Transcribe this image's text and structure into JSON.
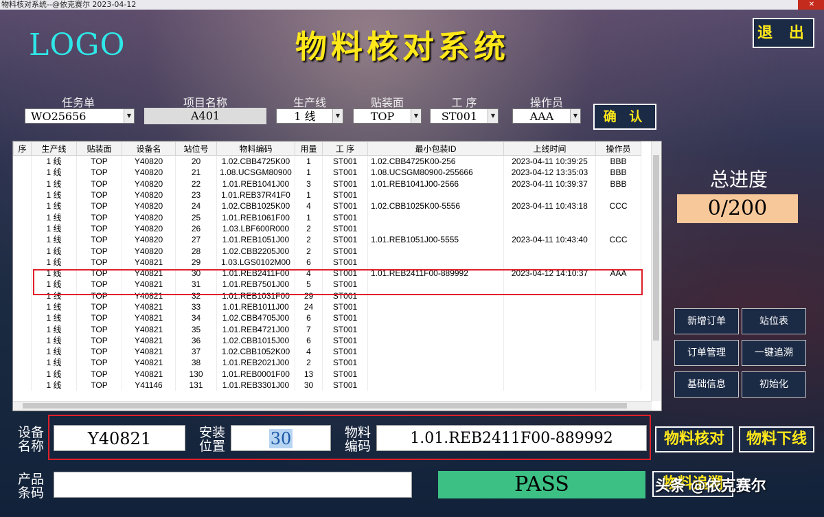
{
  "window": {
    "title": "物料核对系统--@依克赛尔 2023-04-12",
    "close": "✕"
  },
  "header": {
    "logo": "LOGO",
    "title": "物料核对系统",
    "exit_label": "退 出"
  },
  "filters": {
    "task": {
      "label": "任务单",
      "value": "WO25656"
    },
    "project": {
      "label": "项目名称",
      "value": "A401"
    },
    "line": {
      "label": "生产线",
      "value": "1 线"
    },
    "side": {
      "label": "贴装面",
      "value": "TOP"
    },
    "process": {
      "label": "工 序",
      "value": "ST001"
    },
    "operator": {
      "label": "操作员",
      "value": "AAA"
    },
    "confirm_label": "确 认"
  },
  "table": {
    "columns": [
      "序",
      "生产线",
      "贴装面",
      "设备名",
      "站位号",
      "物料编码",
      "用量",
      "工 序",
      "最小包装ID",
      "上线时间",
      "操作员"
    ],
    "rows": [
      [
        "",
        "1 线",
        "TOP",
        "Y40820",
        "20",
        "1.02.CBB4725K00",
        "1",
        "ST001",
        "1.02.CBB4725K00-256",
        "2023-04-11 10:39:25",
        "BBB"
      ],
      [
        "",
        "1 线",
        "TOP",
        "Y40820",
        "21",
        "1.08.UCSGM80900",
        "1",
        "ST001",
        "1.08.UCSGM80900-255666",
        "2023-04-12 13:35:03",
        "BBB"
      ],
      [
        "",
        "1 线",
        "TOP",
        "Y40820",
        "22",
        "1.01.REB1041J00",
        "3",
        "ST001",
        "1.01.REB1041J00-2566",
        "2023-04-11 10:39:37",
        "BBB"
      ],
      [
        "",
        "1 线",
        "TOP",
        "Y40820",
        "23",
        "1.01.REB37R41F0",
        "1",
        "ST001",
        "",
        "",
        ""
      ],
      [
        "",
        "1 线",
        "TOP",
        "Y40820",
        "24",
        "1.02.CBB1025K00",
        "4",
        "ST001",
        "1.02.CBB1025K00-5556",
        "2023-04-11 10:43:18",
        "CCC"
      ],
      [
        "",
        "1 线",
        "TOP",
        "Y40820",
        "25",
        "1.01.REB1061F00",
        "1",
        "ST001",
        "",
        "",
        ""
      ],
      [
        "",
        "1 线",
        "TOP",
        "Y40820",
        "26",
        "1.03.LBF600R000",
        "2",
        "ST001",
        "",
        "",
        ""
      ],
      [
        "",
        "1 线",
        "TOP",
        "Y40820",
        "27",
        "1.01.REB1051J00",
        "2",
        "ST001",
        "1.01.REB1051J00-5555",
        "2023-04-11 10:43:40",
        "CCC"
      ],
      [
        "",
        "1 线",
        "TOP",
        "Y40820",
        "28",
        "1.02.CBB2205J00",
        "2",
        "ST001",
        "",
        "",
        ""
      ],
      [
        "",
        "1 线",
        "TOP",
        "Y40821",
        "29",
        "1.03.LGS0102M00",
        "6",
        "ST001",
        "",
        "",
        ""
      ],
      [
        "",
        "1 线",
        "TOP",
        "Y40821",
        "30",
        "1.01.REB2411F00",
        "4",
        "ST001",
        "1.01.REB2411F00-889992",
        "2023-04-12 14:10:37",
        "AAA"
      ],
      [
        "",
        "1 线",
        "TOP",
        "Y40821",
        "31",
        "1.01.REB7501J00",
        "5",
        "ST001",
        "",
        "",
        ""
      ],
      [
        "",
        "1 线",
        "TOP",
        "Y40821",
        "32",
        "1.01.REB1031F00",
        "29",
        "ST001",
        "",
        "",
        ""
      ],
      [
        "",
        "1 线",
        "TOP",
        "Y40821",
        "33",
        "1.01.REB1011J00",
        "24",
        "ST001",
        "",
        "",
        ""
      ],
      [
        "",
        "1 线",
        "TOP",
        "Y40821",
        "34",
        "1.02.CBB4705J00",
        "6",
        "ST001",
        "",
        "",
        ""
      ],
      [
        "",
        "1 线",
        "TOP",
        "Y40821",
        "35",
        "1.01.REB4721J00",
        "7",
        "ST001",
        "",
        "",
        ""
      ],
      [
        "",
        "1 线",
        "TOP",
        "Y40821",
        "36",
        "1.02.CBB1015J00",
        "6",
        "ST001",
        "",
        "",
        ""
      ],
      [
        "",
        "1 线",
        "TOP",
        "Y40821",
        "37",
        "1.02.CBB1052K00",
        "4",
        "ST001",
        "",
        "",
        ""
      ],
      [
        "",
        "1 线",
        "TOP",
        "Y40821",
        "38",
        "1.01.REB2021J00",
        "2",
        "ST001",
        "",
        "",
        ""
      ],
      [
        "",
        "1 线",
        "TOP",
        "Y40821",
        "130",
        "1.01.REB0001F00",
        "13",
        "ST001",
        "",
        "",
        ""
      ],
      [
        "",
        "1 线",
        "TOP",
        "Y41146",
        "131",
        "1.01.REB3301J00",
        "30",
        "ST001",
        "",
        "",
        ""
      ]
    ],
    "highlighted_row": 10
  },
  "progress": {
    "label": "总进度",
    "value": "0/200"
  },
  "side_buttons": [
    "新增订单",
    "站位表",
    "订单管理",
    "一键追溯",
    "基础信息",
    "初始化"
  ],
  "form": {
    "device_label": "设备\n名称",
    "device_value": "Y40821",
    "position_label": "安装\n位置",
    "position_value": "30",
    "material_label": "物料\n编码",
    "material_value": "1.01.REB2411F00-889992",
    "product_label": "产品\n条码",
    "product_value": "",
    "check_label": "物料核对",
    "offline_label": "物料下线",
    "trace_label": "物料追溯",
    "result": "PASS"
  },
  "watermark": "头条 @依克赛尔",
  "colors": {
    "accent": "#ffe81a",
    "logo": "#2ee8e8",
    "pass": "#3cc084",
    "progress_bg": "#f7c89a",
    "highlight": "#e0202a"
  }
}
